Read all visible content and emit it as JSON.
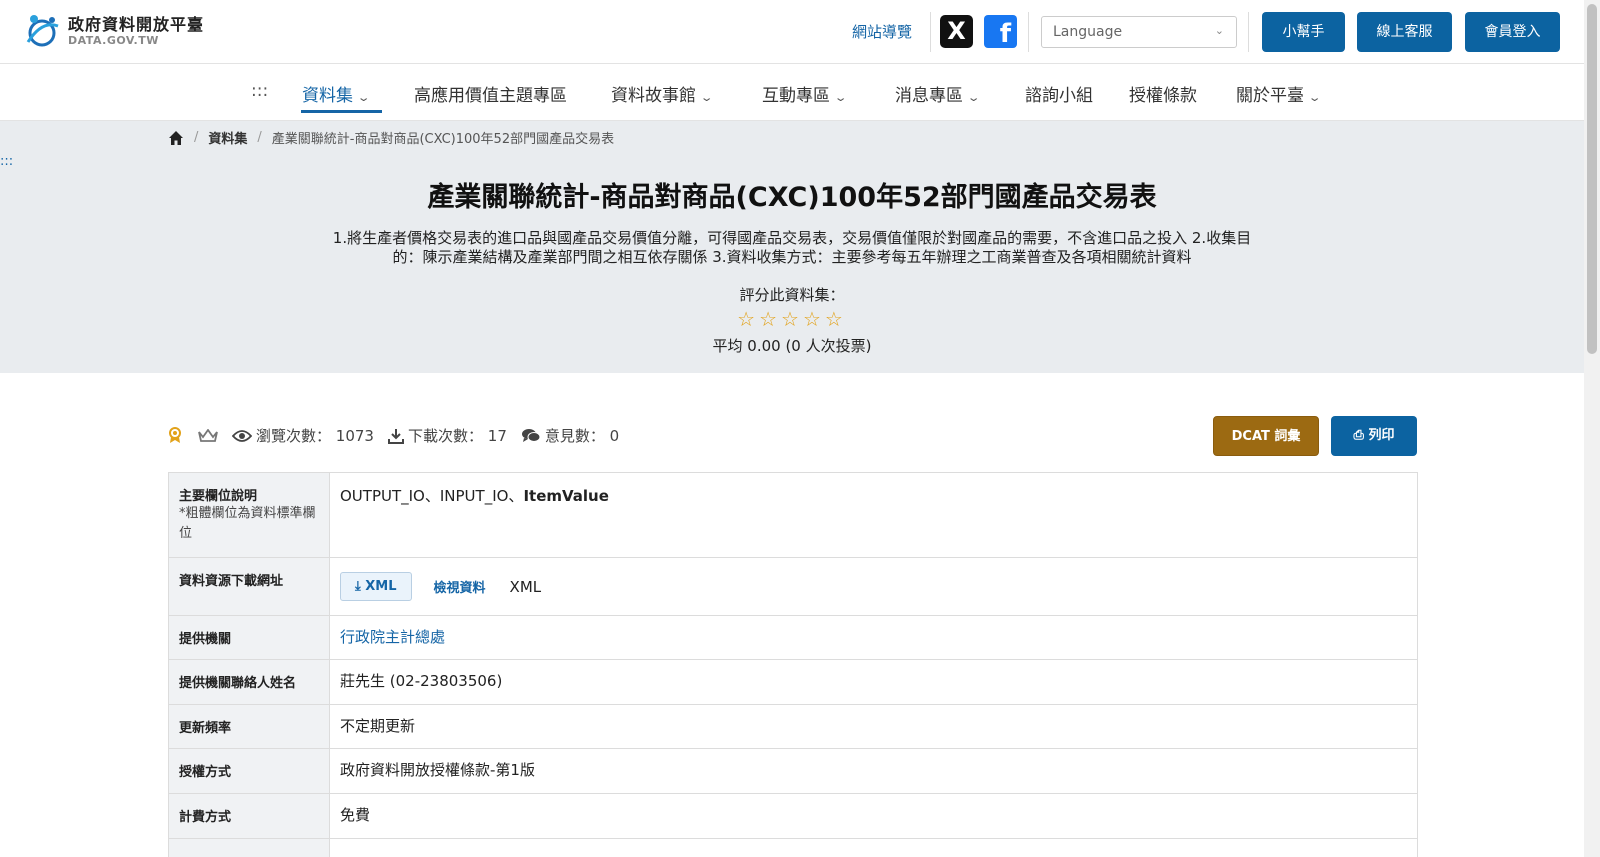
{
  "header": {
    "logo_title": "政府資料開放平臺",
    "logo_sub": "DATA.GOV.TW",
    "sitemap": "網站導覽",
    "x_label": "X",
    "facebook_label": "f",
    "language_placeholder": "Language",
    "buttons": [
      "小幫手",
      "線上客服",
      "會員登入"
    ]
  },
  "nav": {
    "accesskey": ":::",
    "items": [
      "資料集",
      "高應用價值主題專區",
      "資料故事館",
      "互動專區",
      "消息專區",
      "諮詢小組",
      "授權條款",
      "關於平臺"
    ],
    "active": "資料集"
  },
  "breadcrumb": {
    "section": "資料集",
    "current": "產業關聯統計-商品對商品(CXC)100年52部門國產品交易表"
  },
  "hero": {
    "accesskey": ":::",
    "title": "產業關聯統計-商品對商品(CXC)100年52部門國產品交易表",
    "description": "1.將生產者價格交易表的進口品與國產品交易價值分離，可得國產品交易表，交易價值僅限於對國產品的需要，不含進口品之投入 2.收集目的：陳示產業結構及產業部門間之相互依存關係 3.資料收集方式：主要參考每五年辦理之工商業普查及各項相關統計資料",
    "rate_label": "評分此資料集：",
    "stars": "☆☆☆☆☆",
    "rating": 0,
    "average": "平均 0.00 (0 人次投票)"
  },
  "stats": {
    "views_label": "瀏覽次數：",
    "views": "1073",
    "downloads_label": "下載次數：",
    "downloads": "17",
    "comments_label": "意見數：",
    "comments": "0",
    "dcat_button": "DCAT 詞彙",
    "print_button": "列印"
  },
  "table": {
    "fields_label": "主要欄位說明",
    "fields_note": "*粗體欄位為資料標準欄位",
    "fields_plain": "OUTPUT_IO、INPUT_IO、",
    "fields_bold": "ItemValue",
    "download_label": "資料資源下載網址",
    "download_button": "XML",
    "view_data": "檢視資料",
    "download_format": "XML",
    "provider_label": "提供機關",
    "provider": "行政院主計總處",
    "contact_label": "提供機關聯絡人姓名",
    "contact": "莊先生 (02-23803506)",
    "frequency_label": "更新頻率",
    "frequency": "不定期更新",
    "license_label": "授權方式",
    "license": "政府資料開放授權條款-第1版",
    "fee_label": "計費方式",
    "fee": "免費"
  },
  "colors": {
    "primary": "#0c63a1",
    "dcat": "#9c6a12",
    "hero_bg": "#e9ecef",
    "star": "#e2a21a"
  }
}
